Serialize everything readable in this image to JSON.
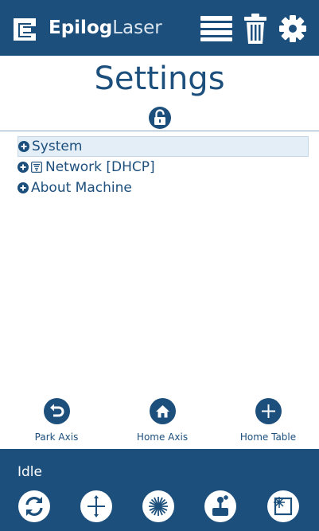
{
  "header": {
    "brand_bold": "Epilog",
    "brand_light": "Laser",
    "icons": [
      "menu-icon",
      "trash-icon",
      "gear-icon"
    ]
  },
  "page": {
    "title": "Settings",
    "lock_icon": "unlocked-padlock-icon"
  },
  "tree": {
    "items": [
      {
        "label": "System",
        "expander": "plus-circle-icon",
        "selected": true
      },
      {
        "label": "Network [DHCP]",
        "expander": "plus-circle-icon",
        "extra_icon": "network-icon"
      },
      {
        "label": "About Machine",
        "expander": "plus-circle-icon"
      }
    ]
  },
  "axis_controls": [
    {
      "label": "Park Axis",
      "icon": "return-arrow-icon"
    },
    {
      "label": "Home Axis",
      "icon": "home-icon"
    },
    {
      "label": "Home Table",
      "icon": "crosshair-icon"
    }
  ],
  "footer": {
    "status": "Idle",
    "buttons": [
      "refresh-icon",
      "jog-icon",
      "laser-pointer-icon",
      "joystick-icon",
      "frame-icon"
    ]
  },
  "colors": {
    "brand": "#1d4f7c",
    "header_bg": "#1d4f7c",
    "selection_bg": "#e4eef6",
    "background": "#ffffff"
  }
}
